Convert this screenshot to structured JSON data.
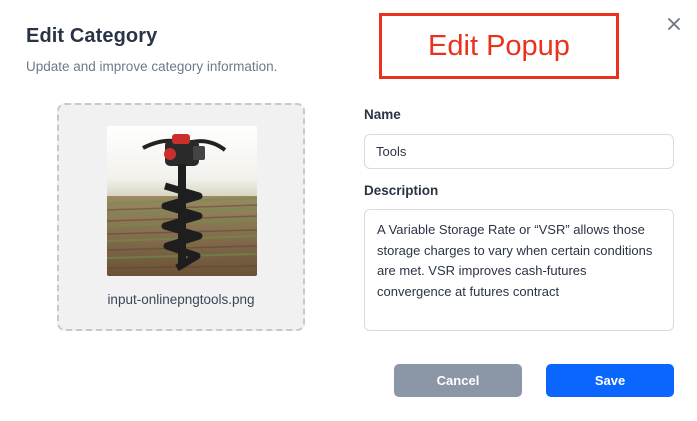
{
  "header": {
    "title": "Edit Category",
    "subtitle": "Update and improve category information."
  },
  "annotation": {
    "text": "Edit Popup"
  },
  "upload": {
    "file_name": "input-onlinepngtools.png"
  },
  "form": {
    "name_label": "Name",
    "name_value": "Tools",
    "description_label": "Description",
    "description_value": "A Variable Storage Rate or “VSR” allows those storage charges to vary when certain conditions are met. VSR improves cash-futures convergence at futures contract"
  },
  "buttons": {
    "cancel_label": "Cancel",
    "save_label": "Save"
  },
  "colors": {
    "primary": "#0b66ff",
    "secondary": "#8b97a7",
    "annotation": "#e8321e"
  },
  "icons": {
    "close": "close-icon"
  }
}
